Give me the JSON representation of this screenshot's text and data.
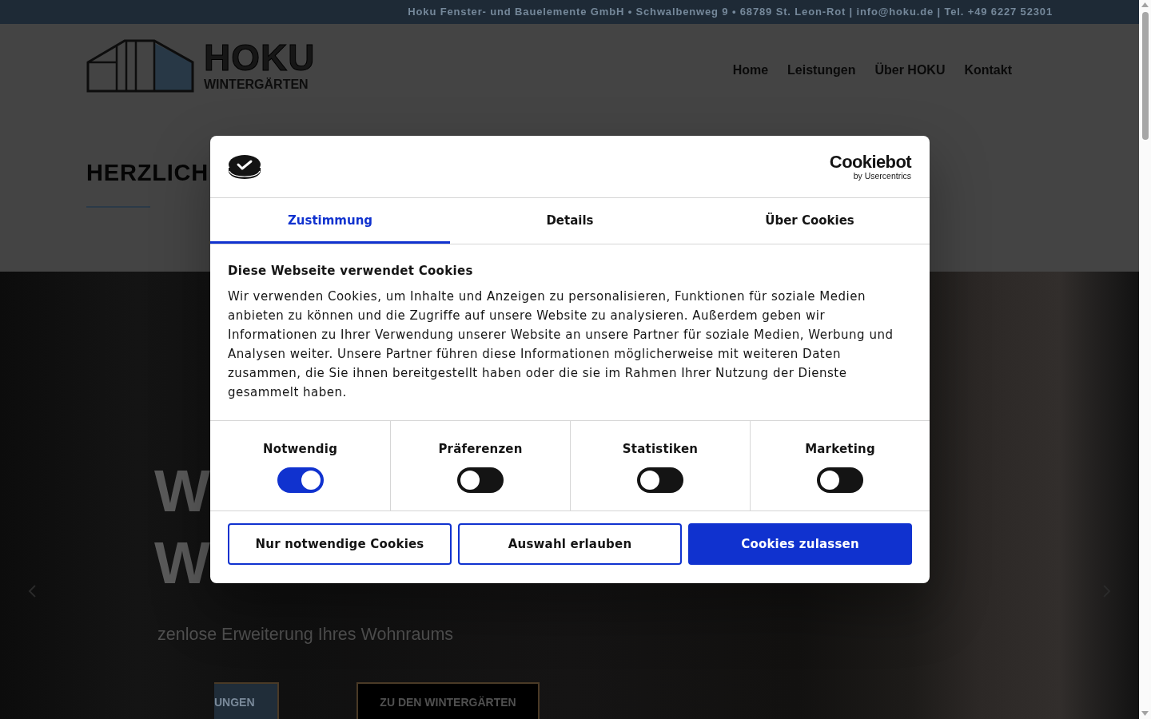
{
  "top_bar": {
    "text": "Hoku Fenster- und Bauelemente GmbH • Schwalbenweg 9 • 68789 St. Leon-Rot | info@hoku.de | Tel. +49 6227 52301"
  },
  "header": {
    "logo": {
      "name": "HOKU",
      "tagline": "WINTERGÄRTEN"
    },
    "nav": [
      {
        "label": "Home"
      },
      {
        "label": "Leistungen"
      },
      {
        "label": "Über HOKU"
      },
      {
        "label": "Kontakt"
      }
    ]
  },
  "intro": {
    "heading": "HERZLICH"
  },
  "hero": {
    "heading_lines": [
      "W",
      "W"
    ],
    "subtitle": "zenlose Erweiterung Ihres Wohnraums",
    "buttons": [
      {
        "label": "UNGEN",
        "kind": "filled"
      },
      {
        "label": "ZU DEN WINTERGÄRTEN",
        "kind": "outline"
      }
    ]
  },
  "cookie_dialog": {
    "brand": {
      "name": "Cookiebot",
      "byline": "by Usercentrics"
    },
    "tabs": [
      {
        "label": "Zustimmung",
        "selected": true
      },
      {
        "label": "Details",
        "selected": false
      },
      {
        "label": "Über Cookies",
        "selected": false
      }
    ],
    "title": "Diese Webseite verwendet Cookies",
    "text": "Wir verwenden Cookies, um Inhalte und Anzeigen zu personalisieren, Funktionen für soziale Medien anbieten zu können und die Zugriffe auf unsere Website zu analysieren. Außerdem geben wir Informationen zu Ihrer Verwendung unserer Website an unsere Partner für soziale Medien, Werbung und Analysen weiter. Unsere Partner führen diese Informationen möglicherweise mit weiteren Daten zusammen, die Sie ihnen bereitgestellt haben oder die sie im Rahmen Ihrer Nutzung der Dienste gesammelt haben.",
    "categories": [
      {
        "label": "Notwendig",
        "checked": true
      },
      {
        "label": "Präferenzen",
        "checked": false
      },
      {
        "label": "Statistiken",
        "checked": false
      },
      {
        "label": "Marketing",
        "checked": false
      }
    ],
    "buttons": [
      {
        "label": "Nur notwendige Cookies",
        "kind": "outline"
      },
      {
        "label": "Auswahl erlauben",
        "kind": "outline"
      },
      {
        "label": "Cookies zulassen",
        "kind": "primary"
      }
    ]
  }
}
